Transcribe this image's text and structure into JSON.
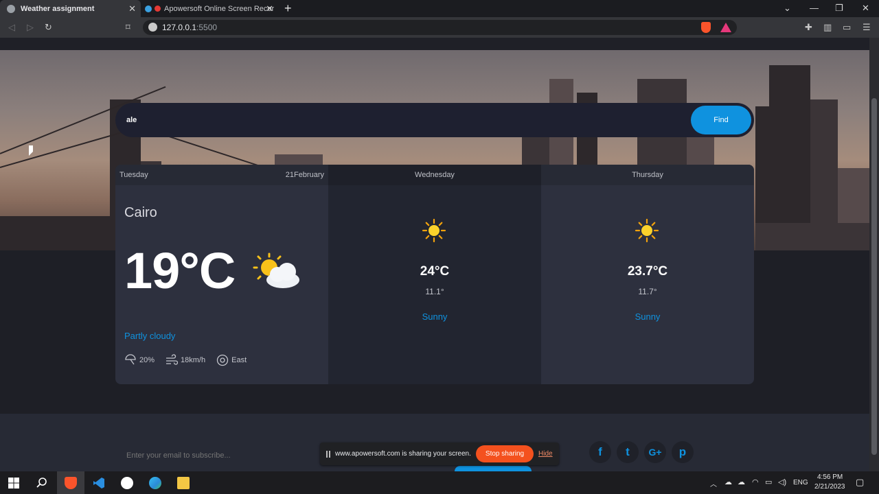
{
  "browser": {
    "tabs": [
      {
        "title": "Weather assignment",
        "active": true
      },
      {
        "title": "Apowersoft Online Screen Recorde",
        "active": false
      }
    ],
    "url_host": "127.0.0.1",
    "url_port": ":5500"
  },
  "search": {
    "value": "ale",
    "button": "Find"
  },
  "today": {
    "day": "Tuesday",
    "date": "21February",
    "city": "Cairo",
    "temp": "19°C",
    "condition": "Partly cloudy",
    "icon": "partly-cloudy-icon",
    "humidity": "20%",
    "wind_speed": "18km/h",
    "wind_dir": "East"
  },
  "forecast": [
    {
      "day": "Wednesday",
      "max": "24°C",
      "min": "11.1°",
      "condition": "Sunny",
      "icon": "sun-icon"
    },
    {
      "day": "Thursday",
      "max": "23.7°C",
      "min": "11.7°",
      "condition": "Sunny",
      "icon": "sun-icon"
    }
  ],
  "footer": {
    "subscribe_placeholder": "Enter your email to subscribe...",
    "social": [
      "f",
      "t",
      "G+",
      "p"
    ]
  },
  "share_banner": {
    "text": "www.apowersoft.com is sharing your screen.",
    "stop": "Stop sharing",
    "hide": "Hide"
  },
  "taskbar": {
    "lang": "ENG",
    "time": "4:56 PM",
    "date": "2/21/2023"
  },
  "colors": {
    "accent": "#0f92df",
    "card": "#2d303e",
    "stop": "#f4511e"
  }
}
